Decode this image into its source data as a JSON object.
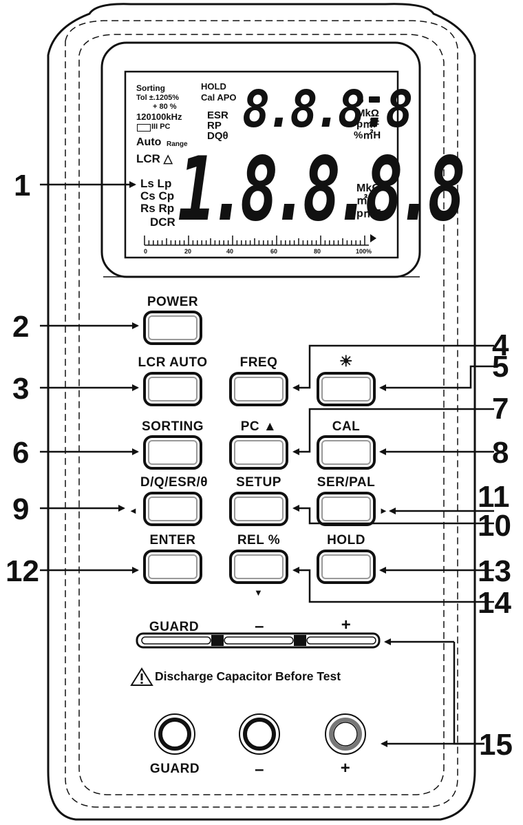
{
  "lcd": {
    "sorting": "Sorting",
    "tol": "Tol ±.1205%",
    "plus80": "+  80  %",
    "freq": "120100kHz",
    "pc": "III PC",
    "auto": "Auto",
    "range": "Range",
    "lcr": "LCR △",
    "hold": "HOLD",
    "cal_apo": "Cal APO",
    "esr": "ESR",
    "rp": "RP",
    "dqo": "DQθ",
    "small_digits": "8.8.8.8",
    "unit_mk": "MkΩ",
    "unit_pmf": "p㎡F",
    "unit_pmh": "%㎡H",
    "ls_lp": "Ls Lp",
    "cs_cp": "Cs Cp",
    "rs_rp": "Rs Rp",
    "dcr": "DCR",
    "big_digits": "1.8.8.8.8",
    "unit2_mk": "MkΩ",
    "unit2_mh": "㎡H",
    "unit2_pmf": "p㎡F",
    "scale": [
      "0",
      "20",
      "40",
      "60",
      "80",
      "100%"
    ]
  },
  "buttons": {
    "power": "POWER",
    "lcr_auto": "LCR AUTO",
    "freq": "FREQ",
    "backlight": "☀",
    "sorting": "SORTING",
    "pc": "PC ▲",
    "cal": "CAL",
    "dqesr": "D/Q/ESR/θ",
    "setup": "SETUP",
    "serpal": "SER/PAL",
    "enter": "ENTER",
    "rel": "REL %",
    "hold": "HOLD"
  },
  "guard_strip": {
    "guard": "GUARD",
    "minus": "–",
    "plus": "+"
  },
  "warning": "Discharge Capacitor Before Test",
  "terminals": {
    "guard": "GUARD",
    "minus": "–",
    "plus": "+"
  },
  "callouts": [
    "1",
    "2",
    "3",
    "4",
    "5",
    "6",
    "7",
    "8",
    "9",
    "10",
    "11",
    "12",
    "13",
    "14",
    "15"
  ],
  "arrow_glyphs": {
    "left": "◄",
    "right": "►",
    "down": "▼"
  }
}
